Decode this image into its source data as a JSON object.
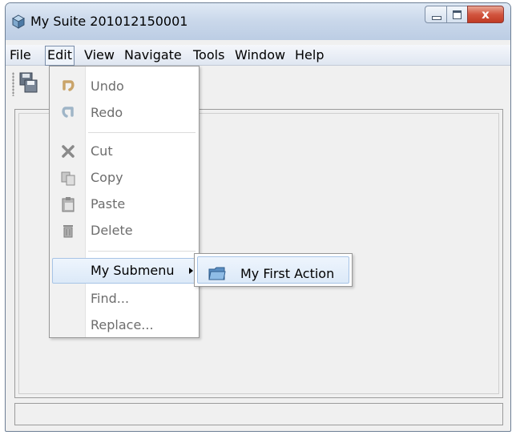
{
  "window": {
    "title": "My Suite 201012150001",
    "close_glyph": "x"
  },
  "menubar": {
    "items": [
      {
        "label": "File"
      },
      {
        "label": "Edit"
      },
      {
        "label": "View"
      },
      {
        "label": "Navigate"
      },
      {
        "label": "Tools"
      },
      {
        "label": "Window"
      },
      {
        "label": "Help"
      }
    ],
    "open_menu": "Edit"
  },
  "edit_menu": {
    "items": [
      {
        "label": "Undo",
        "icon": "undo-icon",
        "enabled": false
      },
      {
        "label": "Redo",
        "icon": "redo-icon",
        "enabled": false
      },
      {
        "label": "Cut",
        "icon": "cut-icon",
        "enabled": false
      },
      {
        "label": "Copy",
        "icon": "copy-icon",
        "enabled": false
      },
      {
        "label": "Paste",
        "icon": "paste-icon",
        "enabled": false
      },
      {
        "label": "Delete",
        "icon": "delete-icon",
        "enabled": false
      },
      {
        "label": "My Submenu",
        "icon": "submenu-arrow-icon",
        "enabled": true,
        "highlighted": true
      },
      {
        "label": "Find...",
        "enabled": false
      },
      {
        "label": "Replace...",
        "enabled": false
      }
    ]
  },
  "submenu": {
    "items": [
      {
        "label": "My First Action",
        "icon": "folder-icon"
      }
    ]
  },
  "toolbar": {
    "icons": [
      "toolbar-grip-icon",
      "save-all-icon"
    ]
  },
  "colors": {
    "menu_highlight": "#dce9f8",
    "highlight_border": "#a7c4e6",
    "disabled_text": "#6d6d6d",
    "close_button": "#c03a23"
  }
}
